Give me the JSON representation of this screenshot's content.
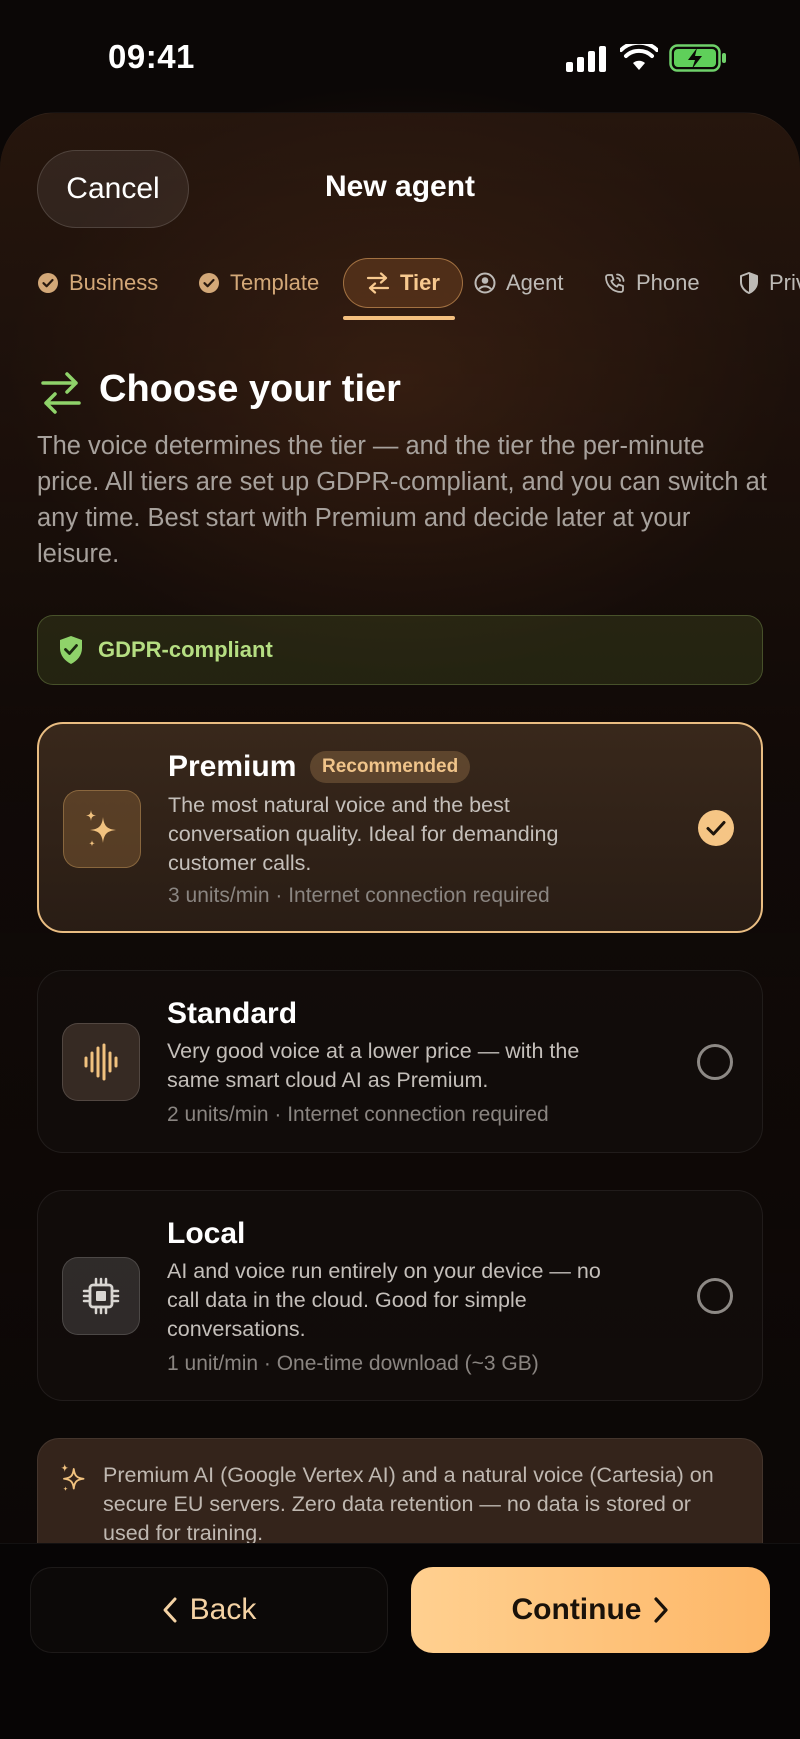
{
  "status_bar": {
    "time": "09:41"
  },
  "nav": {
    "cancel_label": "Cancel",
    "title": "New agent"
  },
  "steps": [
    {
      "label": "Business",
      "state": "done"
    },
    {
      "label": "Template",
      "state": "done"
    },
    {
      "label": "Tier",
      "state": "active"
    },
    {
      "label": "Agent",
      "state": "upcoming"
    },
    {
      "label": "Phone",
      "state": "upcoming"
    },
    {
      "label": "Privacy",
      "state": "upcoming"
    }
  ],
  "heading": "Choose your tier",
  "intro": "The voice determines the tier — and the tier the per-minute price. All tiers are set up GDPR-compliant, and you can switch at any time. Best start with Premium and decide later at your leisure.",
  "gdpr_badge": {
    "label": "GDPR-compliant"
  },
  "tiers": [
    {
      "name": "Premium",
      "badge": "Recommended",
      "description": "The most natural voice and the best conversation quality. Ideal for demanding customer calls.",
      "meta": "3 units/min · Internet connection required",
      "icon": "sparkles-icon",
      "selected": true
    },
    {
      "name": "Standard",
      "description": "Very good voice at a lower price — with the same smart cloud AI as Premium.",
      "meta": "2 units/min · Internet connection required",
      "icon": "waveform-icon",
      "selected": false
    },
    {
      "name": "Local",
      "description": "AI and voice run entirely on your device — no call data in the cloud. Good for simple conversations.",
      "meta": "1 unit/min · One-time download (~3 GB)",
      "icon": "chip-icon",
      "selected": false
    }
  ],
  "info_note": "Premium AI (Google Vertex AI) and a natural voice (Cartesia) on secure EU servers. Zero data retention — no data is stored or used for training.",
  "footer": {
    "back_label": "Back",
    "continue_label": "Continue"
  },
  "colors": {
    "accent": "#f5c585",
    "gdpr_green": "#b5de82",
    "heading_icon_green": "#8fd36a",
    "background": "#0b0706"
  }
}
